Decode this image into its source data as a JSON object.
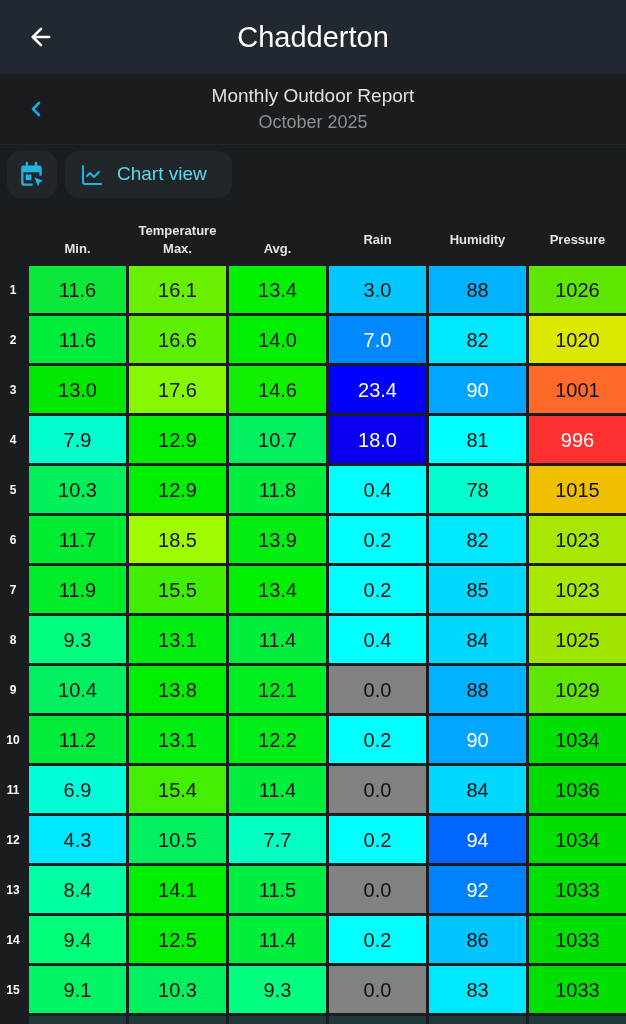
{
  "app_bar": {
    "title": "Chadderton"
  },
  "report": {
    "title": "Monthly Outdoor Report",
    "period": "October 2025"
  },
  "toolbar": {
    "chart_button": {
      "label": "Chart view"
    }
  },
  "table": {
    "column_groups": [
      {
        "label": "Temperature",
        "columns": [
          "Min.",
          "Max.",
          "Avg."
        ]
      },
      {
        "columns": [
          "Rain"
        ]
      },
      {
        "columns": [
          "Humidity"
        ]
      },
      {
        "columns": [
          "Pressure"
        ]
      }
    ],
    "rows": [
      {
        "day": "1",
        "cells": [
          {
            "value": "11.6",
            "color": "#0ce83a"
          },
          {
            "value": "16.1",
            "color": "#68f000"
          },
          {
            "value": "13.4",
            "color": "#00f000"
          },
          {
            "value": "3.0",
            "color": "#00c8ff"
          },
          {
            "value": "88",
            "color": "#00b2ff"
          },
          {
            "value": "1026",
            "color": "#5ee600"
          }
        ]
      },
      {
        "day": "2",
        "cells": [
          {
            "value": "11.6",
            "color": "#00ec3a"
          },
          {
            "value": "16.6",
            "color": "#5eee00"
          },
          {
            "value": "14.0",
            "color": "#00ee00"
          },
          {
            "value": "7.0",
            "color": "#0088ff"
          },
          {
            "value": "82",
            "color": "#00e8ff"
          },
          {
            "value": "1020",
            "color": "#dce800"
          }
        ]
      },
      {
        "day": "3",
        "cells": [
          {
            "value": "13.0",
            "color": "#00e800"
          },
          {
            "value": "17.6",
            "color": "#88f800"
          },
          {
            "value": "14.6",
            "color": "#10f000"
          },
          {
            "value": "23.4",
            "color": "#0000ff"
          },
          {
            "value": "90",
            "color": "#00a6ff"
          },
          {
            "value": "1001",
            "color": "#ff6a2a"
          }
        ]
      },
      {
        "day": "4",
        "cells": [
          {
            "value": "7.9",
            "color": "#00ffcc"
          },
          {
            "value": "12.9",
            "color": "#00ee00"
          },
          {
            "value": "10.7",
            "color": "#00f060"
          },
          {
            "value": "18.0",
            "color": "#0a00f0"
          },
          {
            "value": "81",
            "color": "#00ffff"
          },
          {
            "value": "996",
            "color": "#ff3030"
          }
        ]
      },
      {
        "day": "5",
        "cells": [
          {
            "value": "10.3",
            "color": "#00f05a"
          },
          {
            "value": "12.9",
            "color": "#00ee00"
          },
          {
            "value": "11.8",
            "color": "#00ee3c"
          },
          {
            "value": "0.4",
            "color": "#00ffff"
          },
          {
            "value": "78",
            "color": "#00ffcc"
          },
          {
            "value": "1015",
            "color": "#f0c000"
          }
        ]
      },
      {
        "day": "6",
        "cells": [
          {
            "value": "11.7",
            "color": "#00ec30"
          },
          {
            "value": "18.5",
            "color": "#a0fa00"
          },
          {
            "value": "13.9",
            "color": "#00ee10"
          },
          {
            "value": "0.2",
            "color": "#00ffff"
          },
          {
            "value": "82",
            "color": "#00e8ff"
          },
          {
            "value": "1023",
            "color": "#a8e800"
          }
        ]
      },
      {
        "day": "7",
        "cells": [
          {
            "value": "11.9",
            "color": "#00ec28"
          },
          {
            "value": "15.5",
            "color": "#40ee00"
          },
          {
            "value": "13.4",
            "color": "#00f000"
          },
          {
            "value": "0.2",
            "color": "#00ffff"
          },
          {
            "value": "85",
            "color": "#00d8ff"
          },
          {
            "value": "1023",
            "color": "#a8e800"
          }
        ]
      },
      {
        "day": "8",
        "cells": [
          {
            "value": "9.3",
            "color": "#00ff80"
          },
          {
            "value": "13.1",
            "color": "#00ee10"
          },
          {
            "value": "11.4",
            "color": "#00ee3c"
          },
          {
            "value": "0.4",
            "color": "#00ffff"
          },
          {
            "value": "84",
            "color": "#00d8ff"
          },
          {
            "value": "1025",
            "color": "#a0e400"
          }
        ]
      },
      {
        "day": "9",
        "cells": [
          {
            "value": "10.4",
            "color": "#00f060"
          },
          {
            "value": "13.8",
            "color": "#00ee00"
          },
          {
            "value": "12.1",
            "color": "#00ee20"
          },
          {
            "value": "0.0",
            "color": "#828282"
          },
          {
            "value": "88",
            "color": "#00b2ff"
          },
          {
            "value": "1029",
            "color": "#5ee600"
          }
        ]
      },
      {
        "day": "10",
        "cells": [
          {
            "value": "11.2",
            "color": "#00ec38"
          },
          {
            "value": "13.1",
            "color": "#00ee10"
          },
          {
            "value": "12.2",
            "color": "#00ee18"
          },
          {
            "value": "0.2",
            "color": "#00ffff"
          },
          {
            "value": "90",
            "color": "#00a6ff"
          },
          {
            "value": "1034",
            "color": "#00e000"
          }
        ]
      },
      {
        "day": "11",
        "cells": [
          {
            "value": "6.9",
            "color": "#00ffd8"
          },
          {
            "value": "15.4",
            "color": "#44ee00"
          },
          {
            "value": "11.4",
            "color": "#00ee3c"
          },
          {
            "value": "0.0",
            "color": "#828282"
          },
          {
            "value": "84",
            "color": "#00d8ff"
          },
          {
            "value": "1036",
            "color": "#00dc00"
          }
        ]
      },
      {
        "day": "12",
        "cells": [
          {
            "value": "4.3",
            "color": "#00e8ff"
          },
          {
            "value": "10.5",
            "color": "#00f060"
          },
          {
            "value": "7.7",
            "color": "#00ffc0"
          },
          {
            "value": "0.2",
            "color": "#00ffff"
          },
          {
            "value": "94",
            "color": "#0066ff"
          },
          {
            "value": "1034",
            "color": "#00e000"
          }
        ]
      },
      {
        "day": "13",
        "cells": [
          {
            "value": "8.4",
            "color": "#00ffa0"
          },
          {
            "value": "14.1",
            "color": "#00ee00"
          },
          {
            "value": "11.5",
            "color": "#00ee40"
          },
          {
            "value": "0.0",
            "color": "#828282"
          },
          {
            "value": "92",
            "color": "#0082ff"
          },
          {
            "value": "1033",
            "color": "#00e000"
          }
        ]
      },
      {
        "day": "14",
        "cells": [
          {
            "value": "9.4",
            "color": "#00ff78"
          },
          {
            "value": "12.5",
            "color": "#00ee00"
          },
          {
            "value": "11.4",
            "color": "#00ee3c"
          },
          {
            "value": "0.2",
            "color": "#00ffff"
          },
          {
            "value": "86",
            "color": "#00c4ff"
          },
          {
            "value": "1033",
            "color": "#00e000"
          }
        ]
      },
      {
        "day": "15",
        "cells": [
          {
            "value": "9.1",
            "color": "#00f466"
          },
          {
            "value": "10.3",
            "color": "#00f060"
          },
          {
            "value": "9.3",
            "color": "#00ff80"
          },
          {
            "value": "0.0",
            "color": "#828282"
          },
          {
            "value": "83",
            "color": "#00e8ff"
          },
          {
            "value": "1033",
            "color": "#00e000"
          }
        ]
      },
      {
        "cells": [
          {
            "color": "#213838"
          },
          {
            "color": "#213838"
          },
          {
            "color": "#213838"
          },
          {
            "color": "#213838"
          },
          {
            "color": "#213838"
          },
          {
            "color": "#213838"
          }
        ]
      }
    ]
  }
}
